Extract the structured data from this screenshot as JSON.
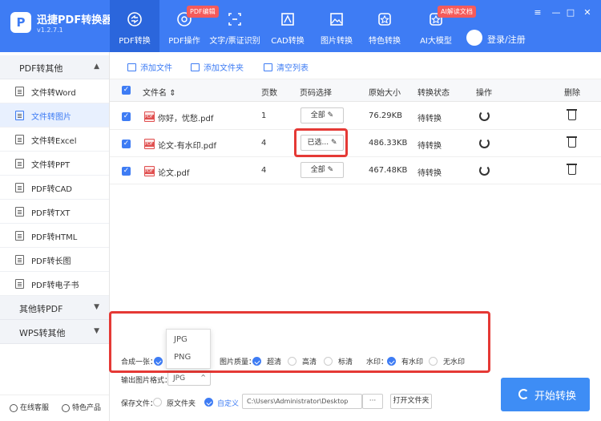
{
  "app": {
    "name": "迅捷PDF转换器",
    "version": "v1.2.7.1",
    "logo": "P"
  },
  "tabs": [
    {
      "label": "PDF转换",
      "icon": "convert-icon"
    },
    {
      "label": "PDF操作",
      "icon": "pdf-operate-icon",
      "badge": "PDF编辑"
    },
    {
      "label": "文字/票证识别",
      "icon": "ocr-icon"
    },
    {
      "label": "CAD转换",
      "icon": "cad-icon"
    },
    {
      "label": "图片转换",
      "icon": "image-icon"
    },
    {
      "label": "特色转换",
      "icon": "star-icon"
    },
    {
      "label": "AI大模型",
      "icon": "ai-icon",
      "badge": "AI解读文档"
    }
  ],
  "login": {
    "label": "登录/注册"
  },
  "window": {
    "menu": "≡",
    "minimize": "—",
    "maximize": "□",
    "close": "✕"
  },
  "sidebar": {
    "section1": "PDF转其他",
    "items": [
      {
        "label": "文件转Word"
      },
      {
        "label": "文件转图片",
        "active": true
      },
      {
        "label": "文件转Excel"
      },
      {
        "label": "文件转PPT"
      },
      {
        "label": "PDF转CAD"
      },
      {
        "label": "PDF转TXT"
      },
      {
        "label": "PDF转HTML"
      },
      {
        "label": "PDF转长图"
      },
      {
        "label": "PDF转电子书"
      }
    ],
    "section2": "其他转PDF",
    "section3": "WPS转其他",
    "footer": {
      "service": "在线客服",
      "products": "特色产品"
    }
  },
  "toolbar": {
    "add_file": "添加文件",
    "add_folder": "添加文件夹",
    "clear_list": "清空列表"
  },
  "table": {
    "headers": {
      "filename": "文件名",
      "pages": "页数",
      "page_select": "页码选择",
      "size": "原始大小",
      "status": "转换状态",
      "action": "操作",
      "delete": "删除"
    },
    "rows": [
      {
        "name": "你好，忧愁.pdf",
        "pages": "1",
        "page_select": "全部",
        "size": "76.29KB",
        "status": "待转换"
      },
      {
        "name": "论文-有水印.pdf",
        "pages": "4",
        "page_select": "已选...",
        "size": "486.33KB",
        "status": "待转换"
      },
      {
        "name": "论文.pdf",
        "pages": "4",
        "page_select": "全部",
        "size": "467.48KB",
        "status": "待转换"
      }
    ]
  },
  "settings": {
    "merge_label": "合成一张：",
    "quality_label": "图片质量：",
    "quality_options": [
      "超清",
      "高清",
      "标清"
    ],
    "watermark_label": "水印：",
    "watermark_options": [
      "有水印",
      "无水印"
    ],
    "format_label": "输出图片格式：",
    "format_value": "JPG",
    "format_options": [
      "JPG",
      "PNG"
    ],
    "save_label": "保存文件：",
    "save_options": [
      "原文件夹",
      "自定义"
    ],
    "save_path": "C:\\Users\\Administrator\\Desktop",
    "more": "···",
    "open_folder": "打开文件夹"
  },
  "start_button": "开始转换",
  "colors": {
    "brand": "#3e7cf4",
    "highlight": "#e53935",
    "badge": "#f45b5b"
  }
}
